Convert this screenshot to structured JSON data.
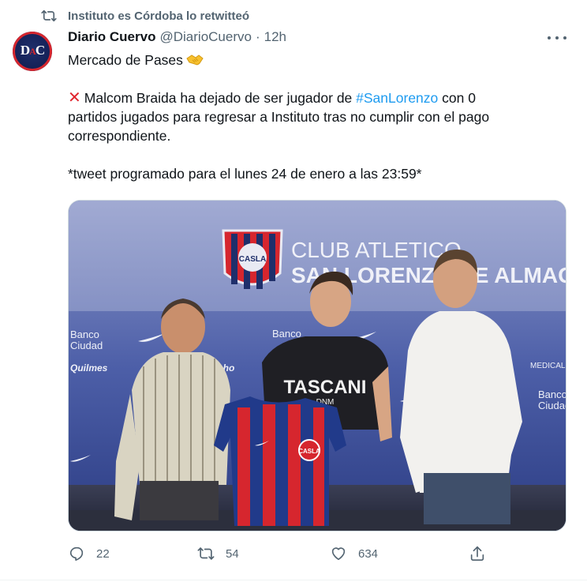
{
  "retweet_banner": {
    "text": "Instituto es Córdoba lo retwitteó"
  },
  "author": {
    "name": "Diario Cuervo",
    "handle": "@DiarioCuervo",
    "separator": "·",
    "time": "12h",
    "avatar_letters": {
      "left": "D",
      "middle": "A",
      "right": "C"
    }
  },
  "tweet": {
    "line1": "Mercado de Pases",
    "line2_prefix": "Malcom Braida ha dejado de ser jugador de",
    "line2_hashtag": "#SanLorenzo",
    "line2_rest": "con 0",
    "line3": "partidos jugados para regresar a Instituto tras no cumplir con el pago",
    "line4": "correspondiente.",
    "line5": "*tweet programado para el lunes 24 de enero a las 23:59*"
  },
  "media": {
    "backdrop_line1": "CLUB ATLETICO",
    "backdrop_line2": "SAN LORENZO DE ALMAGRO",
    "sponsor_banco": "Banco",
    "sponsor_ciudad": "Ciudad",
    "sponsor_quilmes": "Quilmes",
    "sponsor_hecho": "hecho",
    "sponsor_medical": "MEDICAL",
    "shirt_text": "TASCANI",
    "shirt_sub": "DNM",
    "crest_text": "CASLA"
  },
  "actions": {
    "reply_count": "22",
    "retweet_count": "54",
    "like_count": "634"
  },
  "colors": {
    "accent": "#1d9bf0",
    "text_secondary": "#536471",
    "club_red": "#d6262e",
    "club_blue": "#1f2f6b"
  }
}
